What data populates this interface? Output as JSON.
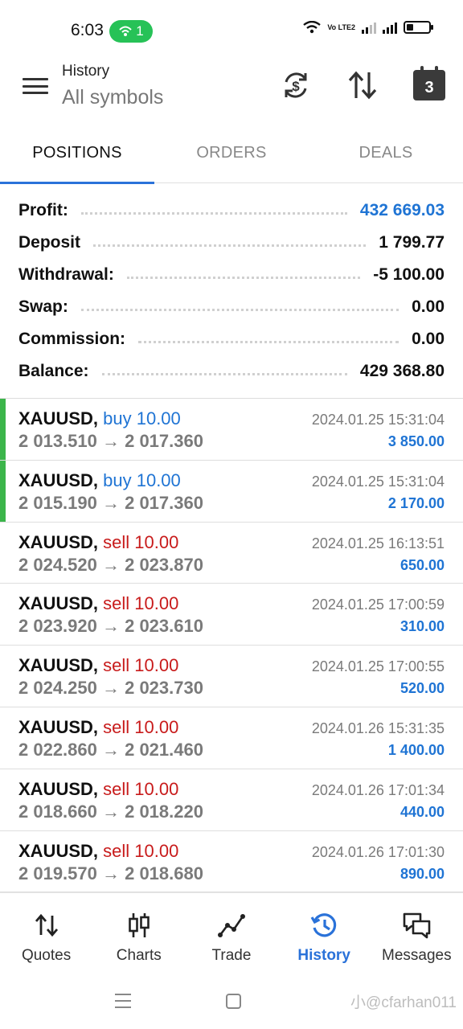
{
  "status_bar": {
    "time": "6:03",
    "hotspot_count": "1",
    "network_label": "Vo LTE2",
    "battery_level": 0.3
  },
  "toolbar": {
    "title": "History",
    "subtitle": "All symbols",
    "calendar_day": "3"
  },
  "tabs": [
    {
      "label": "POSITIONS",
      "active": true
    },
    {
      "label": "ORDERS",
      "active": false
    },
    {
      "label": "DEALS",
      "active": false
    }
  ],
  "summary": [
    {
      "label": "Profit:",
      "value": "432 669.03",
      "highlight": true
    },
    {
      "label": "Deposit",
      "value": "1 799.77",
      "highlight": false
    },
    {
      "label": "Withdrawal:",
      "value": "-5 100.00",
      "highlight": false
    },
    {
      "label": "Swap:",
      "value": "0.00",
      "highlight": false
    },
    {
      "label": "Commission:",
      "value": "0.00",
      "highlight": false
    },
    {
      "label": "Balance:",
      "value": "429 368.80",
      "highlight": false
    }
  ],
  "deals": [
    {
      "symbol": "XAUUSD,",
      "side": "buy 10.00",
      "side_type": "buy",
      "prices": "2 013.510 → 2 017.360",
      "time": "2024.01.25 15:31:04",
      "profit": "3 850.00",
      "marker": true
    },
    {
      "symbol": "XAUUSD,",
      "side": "buy 10.00",
      "side_type": "buy",
      "prices": "2 015.190 → 2 017.360",
      "time": "2024.01.25 15:31:04",
      "profit": "2 170.00",
      "marker": true
    },
    {
      "symbol": "XAUUSD,",
      "side": "sell 10.00",
      "side_type": "sell",
      "prices": "2 024.520 → 2 023.870",
      "time": "2024.01.25 16:13:51",
      "profit": "650.00",
      "marker": false
    },
    {
      "symbol": "XAUUSD,",
      "side": "sell 10.00",
      "side_type": "sell",
      "prices": "2 023.920 → 2 023.610",
      "time": "2024.01.25 17:00:59",
      "profit": "310.00",
      "marker": false
    },
    {
      "symbol": "XAUUSD,",
      "side": "sell 10.00",
      "side_type": "sell",
      "prices": "2 024.250 → 2 023.730",
      "time": "2024.01.25 17:00:55",
      "profit": "520.00",
      "marker": false
    },
    {
      "symbol": "XAUUSD,",
      "side": "sell 10.00",
      "side_type": "sell",
      "prices": "2 022.860 → 2 021.460",
      "time": "2024.01.26 15:31:35",
      "profit": "1 400.00",
      "marker": false
    },
    {
      "symbol": "XAUUSD,",
      "side": "sell 10.00",
      "side_type": "sell",
      "prices": "2 018.660 → 2 018.220",
      "time": "2024.01.26 17:01:34",
      "profit": "440.00",
      "marker": false
    },
    {
      "symbol": "XAUUSD,",
      "side": "sell 10.00",
      "side_type": "sell",
      "prices": "2 019.570 → 2 018.680",
      "time": "2024.01.26 17:01:30",
      "profit": "890.00",
      "marker": false
    }
  ],
  "bottom_nav": [
    {
      "label": "Quotes",
      "icon": "quotes-icon",
      "active": false
    },
    {
      "label": "Charts",
      "icon": "charts-icon",
      "active": false
    },
    {
      "label": "Trade",
      "icon": "trade-icon",
      "active": false
    },
    {
      "label": "History",
      "icon": "history-icon",
      "active": true
    },
    {
      "label": "Messages",
      "icon": "messages-icon",
      "active": false
    }
  ],
  "watermark": "小@cfarhan011",
  "colors": {
    "accent": "#2a72d9",
    "profit_blue": "#1f74d4",
    "sell_red": "#c81b1b",
    "open_marker": "#3bb54a",
    "hotspot_green": "#27c257"
  }
}
